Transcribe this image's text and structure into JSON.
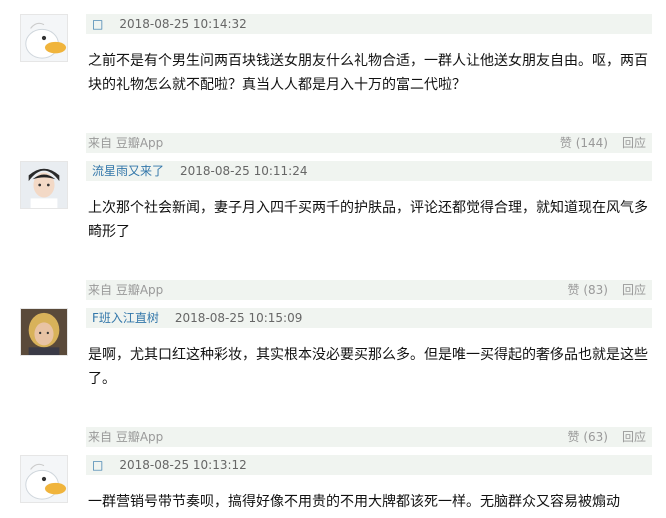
{
  "comments": [
    {
      "author": "□",
      "time": "2018-08-25 10:14:32",
      "text": "之前不是有个男生问两百块钱送女朋友什么礼物合适，一群人让他送女朋友自由。呕，两百块的礼物怎么就不配啦？真当人人都是月入十万的富二代啦？",
      "via": "来自 豆瓣App",
      "vote": "赞 (144)",
      "reply": "回应"
    },
    {
      "author": "流星雨又来了",
      "time": "2018-08-25 10:11:24",
      "text": "上次那个社会新闻，妻子月入四千买两千的护肤品，评论还都觉得合理，就知道现在风气多畸形了",
      "via": "来自 豆瓣App",
      "vote": "赞 (83)",
      "reply": "回应"
    },
    {
      "author": "F班入江直树",
      "time": "2018-08-25 10:15:09",
      "text": "是啊，尤其口红这种彩妆，其实根本没必要买那么多。但是唯一买得起的奢侈品也就是这些了。",
      "via": "来自 豆瓣App",
      "vote": "赞 (63)",
      "reply": "回应"
    },
    {
      "author": "□",
      "time": "2018-08-25 10:13:12",
      "text": "一群营销号带节奏呗，搞得好像不用贵的不用大牌都该死一样。无脑群众又容易被煽动"
    }
  ],
  "colors": {
    "author": "#3377aa",
    "bar_bg": "#f0f4f0",
    "muted": "#999999"
  }
}
